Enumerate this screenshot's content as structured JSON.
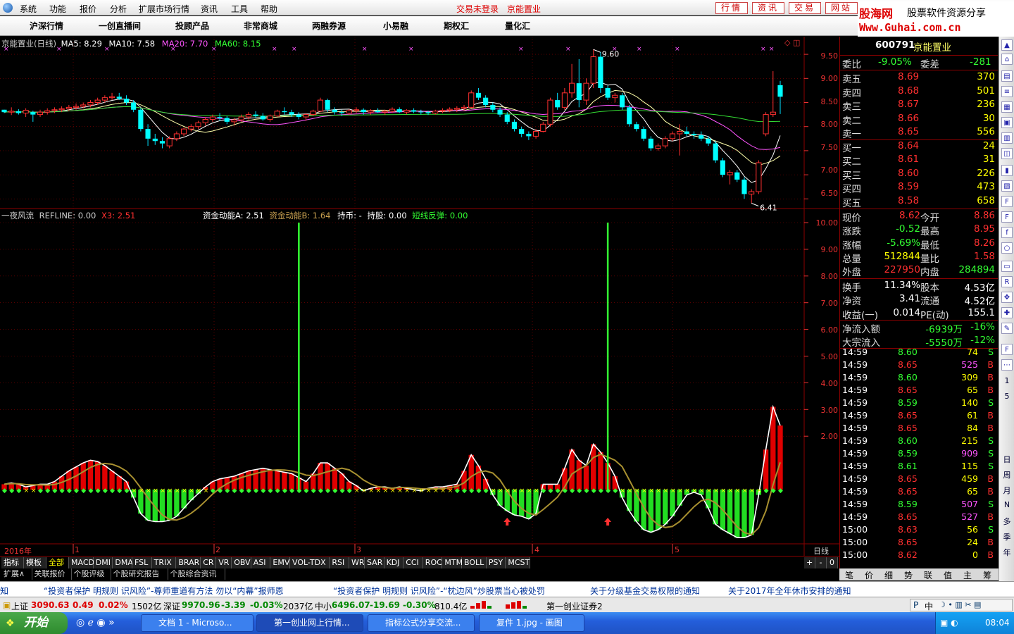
{
  "menu": {
    "items": [
      "系统",
      "功能",
      "报价",
      "分析",
      "扩展市场行情",
      "资讯",
      "工具",
      "帮助"
    ],
    "login_status": "交易未登录",
    "stock_name_top": "京能置业",
    "top_buttons": [
      "行情",
      "资讯",
      "交易",
      "网站"
    ]
  },
  "brand": {
    "name": "股海网",
    "slogan": "股票软件资源分享",
    "url": "Www.Guhai.com.cn"
  },
  "nav": {
    "items": [
      "沪深行情",
      "一创直播间",
      "投顾产品",
      "非常商城",
      "两融券源",
      "小易融",
      "期权汇",
      "量化汇"
    ]
  },
  "price_panel": {
    "title": "京能置业(日线)",
    "ma": [
      {
        "label": "MA5: 8.29",
        "color": "#ffffff"
      },
      {
        "label": "MA10: 7.58",
        "color": "#ffffff"
      },
      {
        "label": "MA20: 7.70",
        "color": "#ff55ff"
      },
      {
        "label": "MA60: 8.15",
        "color": "#33ff33"
      }
    ],
    "high_mark": "9.60",
    "low_mark": "6.41",
    "y_labels": [
      "9.50",
      "9.00",
      "8.50",
      "8.00",
      "7.50",
      "7.00",
      "6.50"
    ]
  },
  "indicator_panel": {
    "name": "一夜风流",
    "refline": "REFLINE: 0.00",
    "x3": "X3: 2.51",
    "a": "资金动能A: 2.51",
    "b": "资金动能B: 1.64",
    "hold_coin": "持币: -",
    "hold_stock": "持股: 0.00",
    "rebound": "短线反弹: 0.00",
    "y_labels": [
      "10.00",
      "9.00",
      "8.00",
      "7.00",
      "6.00",
      "5.00",
      "4.00",
      "3.00",
      "2.00"
    ]
  },
  "x_axis": {
    "labels": [
      "2016年",
      "1",
      "2",
      "3",
      "4",
      "5"
    ],
    "period": "日线",
    "controls": [
      "+",
      "-",
      "0"
    ]
  },
  "indicator_tabs": [
    "指标",
    "模板",
    "全部",
    "MACD",
    "DMI",
    "DMA",
    "FSL",
    "TRIX",
    "BRAR",
    "CR",
    "VR",
    "OBV",
    "ASI",
    "EMV",
    "VOL-TDX",
    "RSI",
    "WR",
    "SAR",
    "KDJ",
    "CCI",
    "ROC",
    "MTM",
    "BOLL",
    "PSY",
    "MCST"
  ],
  "bottom_tabs": [
    "扩展∧",
    "关联报价",
    "个股评级",
    "个股研究报告",
    "个股综合资讯"
  ],
  "quote": {
    "code": "600791",
    "name": "京能置业",
    "weibi_label": "委比",
    "weibi": "-9.05%",
    "weicha_label": "委差",
    "weicha": "-281",
    "sell": [
      {
        "label": "卖五",
        "price": "8.69",
        "vol": "370"
      },
      {
        "label": "卖四",
        "price": "8.68",
        "vol": "501"
      },
      {
        "label": "卖三",
        "price": "8.67",
        "vol": "236"
      },
      {
        "label": "卖二",
        "price": "8.66",
        "vol": "30"
      },
      {
        "label": "卖一",
        "price": "8.65",
        "vol": "556"
      }
    ],
    "buy": [
      {
        "label": "买一",
        "price": "8.64",
        "vol": "24"
      },
      {
        "label": "买二",
        "price": "8.61",
        "vol": "31"
      },
      {
        "label": "买三",
        "price": "8.60",
        "vol": "226"
      },
      {
        "label": "买四",
        "price": "8.59",
        "vol": "473"
      },
      {
        "label": "买五",
        "price": "8.58",
        "vol": "658"
      }
    ],
    "stats": [
      {
        "l1": "现价",
        "v1": "8.62",
        "c1": "#ff3030",
        "l2": "今开",
        "v2": "8.86",
        "c2": "#ff3030"
      },
      {
        "l1": "涨跌",
        "v1": "-0.52",
        "c1": "#33ff33",
        "l2": "最高",
        "v2": "8.95",
        "c2": "#ff3030"
      },
      {
        "l1": "涨幅",
        "v1": "-5.69%",
        "c1": "#33ff33",
        "l2": "最低",
        "v2": "8.26",
        "c2": "#ff3030"
      },
      {
        "l1": "总量",
        "v1": "512844",
        "c1": "#ffff00",
        "l2": "量比",
        "v2": "1.58",
        "c2": "#ff3030"
      },
      {
        "l1": "外盘",
        "v1": "227950",
        "c1": "#ff3030",
        "l2": "内盘",
        "v2": "284894",
        "c2": "#33ff33"
      }
    ],
    "stats2": [
      {
        "l1": "换手",
        "v1": "11.34%",
        "l2": "股本",
        "v2": "4.53亿"
      },
      {
        "l1": "净资",
        "v1": "3.41",
        "l2": "流通",
        "v2": "4.52亿"
      },
      {
        "l1": "收益(一)",
        "v1": "0.014",
        "l2": "PE(动)",
        "v2": "155.1"
      }
    ],
    "flow": [
      {
        "label": "净流入额",
        "value": "-6939万",
        "pct": "-16%"
      },
      {
        "label": "大宗流入",
        "value": "-5550万",
        "pct": "-12%"
      }
    ],
    "ticks": [
      {
        "t": "14:59",
        "p": "8.60",
        "v": "74",
        "s": "S",
        "vc": "#ffff00"
      },
      {
        "t": "14:59",
        "p": "8.65",
        "v": "525",
        "s": "B",
        "vc": "#ff55ff"
      },
      {
        "t": "14:59",
        "p": "8.60",
        "v": "309",
        "s": "B",
        "vc": "#ffff00"
      },
      {
        "t": "14:59",
        "p": "8.65",
        "v": "65",
        "s": "B",
        "vc": "#ffff00"
      },
      {
        "t": "14:59",
        "p": "8.59",
        "v": "140",
        "s": "S",
        "vc": "#ffff00"
      },
      {
        "t": "14:59",
        "p": "8.65",
        "v": "61",
        "s": "B",
        "vc": "#ffff00"
      },
      {
        "t": "14:59",
        "p": "8.65",
        "v": "84",
        "s": "B",
        "vc": "#ffff00"
      },
      {
        "t": "14:59",
        "p": "8.60",
        "v": "215",
        "s": "S",
        "vc": "#ffff00"
      },
      {
        "t": "14:59",
        "p": "8.59",
        "v": "909",
        "s": "S",
        "vc": "#ff55ff"
      },
      {
        "t": "14:59",
        "p": "8.61",
        "v": "115",
        "s": "S",
        "vc": "#ffff00"
      },
      {
        "t": "14:59",
        "p": "8.65",
        "v": "459",
        "s": "B",
        "vc": "#ffff00"
      },
      {
        "t": "14:59",
        "p": "8.65",
        "v": "65",
        "s": "B",
        "vc": "#ffff00"
      },
      {
        "t": "14:59",
        "p": "8.59",
        "v": "507",
        "s": "S",
        "vc": "#ff55ff"
      },
      {
        "t": "14:59",
        "p": "8.65",
        "v": "527",
        "s": "B",
        "vc": "#ff55ff"
      },
      {
        "t": "15:00",
        "p": "8.63",
        "v": "56",
        "s": "S",
        "vc": "#ffff00"
      },
      {
        "t": "15:00",
        "p": "8.65",
        "v": "24",
        "s": "B",
        "vc": "#ffff00"
      },
      {
        "t": "15:00",
        "p": "8.62",
        "v": "0",
        "s": "B",
        "vc": "#ffff00"
      }
    ],
    "tabs": [
      "笔",
      "价",
      "细",
      "势",
      "联",
      "值",
      "主",
      "筹"
    ]
  },
  "tool_column": [
    "1",
    "5",
    "日",
    "周",
    "月",
    "N",
    "多",
    "季",
    "年"
  ],
  "ticker": [
    "知",
    "“投资者保护 明规则 识风险”-尊师重道有方法 勿以“内幕”报师恩",
    "“投资者保护 明规则 识风险”-“枕边风”炒股票当心被处罚",
    "关于分级基金交易权限的通知",
    "关于2017年全年休市安排的通知"
  ],
  "status_bar": {
    "sh_label": "上证",
    "sh": "3090.63",
    "sh_chg": "0.49",
    "sh_pct": "0.02%",
    "sh_amt": "1502亿",
    "sz_label": "深证",
    "sz": "9970.96",
    "sz_chg": "-3.39",
    "sz_pct": "-0.03%",
    "sz_amt": "2037亿",
    "zx_label": "中小",
    "zx": "6496.07",
    "zx_chg": "-19.69",
    "zx_pct": "-0.30%",
    "zx_amt": "810.4亿",
    "server": "第一创业证券2"
  },
  "taskbar": {
    "start": "开始",
    "tasks": [
      "文档 1 - Microso...",
      "第一创业网上行情...",
      "指标公式分享交流...",
      "复件 1.jpg - 画图"
    ],
    "tray_ime": "中",
    "clock": "08:04"
  },
  "chart_data": {
    "type": "candlestick+indicator",
    "price_axis_range": [
      6.3,
      9.75
    ],
    "indicator_axis_range": [
      -1.2,
      10.5
    ],
    "candles": [
      [
        8.35,
        8.35,
        8.28,
        8.3
      ],
      [
        8.3,
        8.4,
        8.24,
        8.32
      ],
      [
        8.32,
        8.36,
        8.25,
        8.28
      ],
      [
        8.28,
        8.38,
        8.2,
        8.34
      ],
      [
        8.3,
        8.33,
        8.1,
        8.25
      ],
      [
        8.25,
        8.35,
        8.2,
        8.3
      ],
      [
        8.3,
        8.38,
        8.25,
        8.33
      ],
      [
        8.33,
        8.4,
        8.28,
        8.35
      ],
      [
        8.35,
        8.42,
        8.3,
        8.37
      ],
      [
        8.37,
        8.45,
        8.32,
        8.4
      ],
      [
        8.4,
        8.48,
        8.35,
        8.42
      ],
      [
        8.42,
        8.5,
        8.38,
        8.45
      ],
      [
        8.45,
        8.55,
        8.4,
        8.5
      ],
      [
        8.5,
        8.6,
        8.45,
        8.55
      ],
      [
        8.55,
        8.65,
        8.5,
        8.6
      ],
      [
        8.6,
        8.7,
        8.55,
        8.62
      ],
      [
        8.62,
        8.7,
        8.55,
        8.58
      ],
      [
        8.58,
        8.65,
        8.45,
        8.5
      ],
      [
        8.5,
        8.55,
        8.3,
        8.35
      ],
      [
        8.35,
        8.38,
        7.9,
        7.95
      ],
      [
        7.95,
        8.05,
        7.6,
        7.75
      ],
      [
        7.75,
        7.85,
        7.62,
        7.7
      ],
      [
        7.7,
        7.78,
        7.55,
        7.65
      ],
      [
        7.6,
        7.8,
        7.55,
        7.75
      ],
      [
        7.75,
        7.9,
        7.7,
        7.85
      ],
      [
        7.85,
        7.98,
        7.8,
        7.95
      ],
      [
        7.95,
        8.05,
        7.9,
        8.0
      ],
      [
        8.0,
        8.12,
        7.95,
        8.08
      ],
      [
        8.08,
        8.2,
        8.02,
        8.15
      ],
      [
        8.15,
        8.25,
        8.1,
        8.2
      ],
      [
        8.2,
        8.28,
        8.12,
        8.18
      ],
      [
        8.18,
        8.22,
        8.05,
        8.1
      ],
      [
        8.1,
        8.18,
        8.02,
        8.14
      ],
      [
        8.14,
        8.25,
        8.1,
        8.2
      ],
      [
        8.2,
        8.3,
        8.15,
        8.25
      ],
      [
        8.25,
        8.32,
        8.18,
        8.22
      ],
      [
        8.22,
        8.28,
        8.12,
        8.15
      ],
      [
        8.15,
        8.25,
        8.1,
        8.22
      ],
      [
        8.22,
        8.35,
        8.2,
        8.32
      ],
      [
        8.32,
        8.4,
        8.25,
        8.3
      ],
      [
        8.3,
        8.35,
        8.2,
        8.25
      ],
      [
        8.25,
        8.3,
        8.15,
        8.2
      ],
      [
        8.2,
        8.28,
        8.12,
        8.25
      ],
      [
        8.25,
        8.35,
        8.22,
        8.32
      ],
      [
        8.32,
        8.6,
        8.3,
        8.55
      ],
      [
        8.55,
        8.58,
        8.3,
        8.35
      ],
      [
        8.35,
        8.4,
        8.25,
        8.3
      ],
      [
        8.3,
        8.35,
        8.22,
        8.28
      ],
      [
        8.28,
        8.36,
        8.24,
        8.33
      ],
      [
        8.33,
        8.4,
        8.28,
        8.35
      ],
      [
        8.35,
        8.38,
        8.25,
        8.3
      ],
      [
        8.3,
        8.36,
        8.25,
        8.33
      ],
      [
        8.33,
        8.38,
        8.28,
        8.3
      ],
      [
        8.3,
        8.35,
        8.24,
        8.32
      ],
      [
        8.32,
        8.4,
        8.28,
        8.36
      ],
      [
        8.36,
        8.4,
        8.28,
        8.3
      ],
      [
        8.3,
        8.36,
        8.25,
        8.34
      ],
      [
        8.34,
        8.38,
        8.28,
        8.31
      ],
      [
        8.31,
        8.35,
        8.25,
        8.3
      ],
      [
        8.3,
        8.33,
        8.24,
        8.28
      ],
      [
        8.28,
        8.35,
        8.25,
        8.32
      ],
      [
        8.32,
        8.38,
        8.28,
        8.34
      ],
      [
        8.34,
        8.4,
        8.3,
        8.36
      ],
      [
        8.36,
        8.42,
        8.3,
        8.38
      ],
      [
        8.38,
        8.45,
        8.33,
        8.4
      ],
      [
        8.4,
        8.75,
        8.38,
        8.7
      ],
      [
        8.7,
        8.8,
        8.55,
        8.6
      ],
      [
        8.6,
        8.65,
        8.4,
        8.45
      ],
      [
        8.45,
        8.5,
        8.3,
        8.35
      ],
      [
        8.35,
        8.4,
        8.2,
        8.25
      ],
      [
        8.25,
        8.3,
        8.05,
        8.1
      ],
      [
        8.1,
        8.15,
        7.9,
        7.95
      ],
      [
        7.95,
        8.0,
        7.78,
        7.85
      ],
      [
        7.85,
        7.9,
        7.72,
        7.8
      ],
      [
        7.8,
        7.95,
        7.75,
        7.9
      ],
      [
        7.9,
        8.1,
        7.88,
        8.05
      ],
      [
        8.05,
        8.6,
        8.0,
        8.55
      ],
      [
        8.55,
        8.7,
        8.35,
        8.4
      ],
      [
        8.4,
        8.8,
        8.35,
        8.7
      ],
      [
        8.7,
        9.3,
        8.6,
        8.9
      ],
      [
        8.9,
        9.4,
        8.4,
        8.55
      ],
      [
        8.55,
        9.0,
        8.45,
        8.9
      ],
      [
        8.9,
        9.6,
        8.8,
        9.45
      ],
      [
        9.45,
        9.55,
        8.7,
        8.8
      ],
      [
        8.8,
        8.85,
        8.55,
        8.6
      ],
      [
        8.6,
        8.7,
        8.5,
        8.65
      ],
      [
        8.65,
        8.7,
        8.35,
        8.4
      ],
      [
        8.4,
        8.45,
        8.0,
        8.05
      ],
      [
        8.05,
        8.1,
        7.9,
        7.95
      ],
      [
        7.95,
        8.0,
        7.7,
        7.75
      ],
      [
        7.75,
        7.8,
        7.5,
        7.55
      ],
      [
        7.55,
        7.65,
        7.5,
        7.6
      ],
      [
        7.6,
        7.8,
        7.55,
        7.75
      ],
      [
        7.75,
        7.9,
        7.7,
        7.85
      ],
      [
        7.85,
        8.05,
        7.4,
        7.9
      ],
      [
        7.9,
        8.0,
        7.8,
        7.85
      ],
      [
        7.85,
        7.9,
        7.75,
        7.82
      ],
      [
        7.82,
        7.9,
        7.7,
        7.75
      ],
      [
        7.75,
        7.8,
        7.6,
        7.65
      ],
      [
        7.65,
        7.7,
        7.25,
        7.3
      ],
      [
        7.3,
        7.35,
        6.95,
        7.0
      ],
      [
        7.0,
        7.1,
        6.8,
        7.05
      ],
      [
        7.05,
        7.1,
        6.85,
        6.9
      ],
      [
        6.9,
        6.95,
        6.5,
        6.6
      ],
      [
        6.6,
        6.7,
        6.41,
        6.65
      ],
      [
        6.65,
        7.3,
        6.6,
        7.25
      ],
      [
        7.85,
        8.3,
        7.8,
        8.25
      ],
      [
        8.25,
        9.15,
        8.2,
        8.3
      ],
      [
        8.86,
        8.95,
        8.26,
        8.62
      ]
    ],
    "indicator_values": [
      0.2,
      0.25,
      0.2,
      0.1,
      0.15,
      0.2,
      0.2,
      0.3,
      0.5,
      0.7,
      0.85,
      1.0,
      1.1,
      1.05,
      0.9,
      0.7,
      0.5,
      0.3,
      -0.3,
      -0.9,
      -1.15,
      -1.2,
      -1.2,
      -1.15,
      -1.0,
      -0.7,
      -0.4,
      -0.15,
      0.1,
      0.3,
      0.4,
      0.45,
      0.5,
      0.6,
      0.7,
      0.75,
      0.8,
      0.75,
      0.7,
      0.65,
      0.6,
      0.45,
      0.3,
      0.6,
      1.0,
      1.0,
      0.8,
      0.6,
      0.3,
      0.15,
      -0.05,
      0.05,
      0.1,
      0.1,
      0.05,
      0.1,
      0.05,
      0.0,
      -0.05,
      0.05,
      0.1,
      0.1,
      0.15,
      0.2,
      0.7,
      1.3,
      0.9,
      0.4,
      -0.2,
      -0.6,
      -0.8,
      -0.95,
      -1.0,
      -1.1,
      -0.9,
      0.2,
      0.2,
      0.2,
      0.8,
      1.5,
      1.1,
      0.9,
      1.7,
      1.4,
      1.0,
      0.5,
      -0.3,
      -0.8,
      -1.2,
      -1.5,
      -1.6,
      -1.5,
      -1.3,
      -1.0,
      -0.6,
      -0.2,
      -0.1,
      -0.2,
      -0.7,
      -1.3,
      -1.5,
      -1.65,
      -1.8,
      -1.8,
      -1.7,
      -0.2,
      1.5,
      3.1,
      2.4
    ],
    "signal_lines": [
      41,
      84,
      120
    ],
    "arrows": [
      70,
      84
    ]
  }
}
